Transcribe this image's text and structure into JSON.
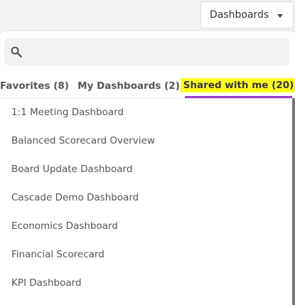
{
  "dropdown_button": {
    "label": "Dashboards"
  },
  "search": {
    "placeholder": "",
    "value": ""
  },
  "tabs": [
    {
      "label": "Favorites (8)",
      "active": false
    },
    {
      "label": "My Dashboards (2)",
      "active": false
    },
    {
      "label": "Shared with me (20)",
      "active": true
    }
  ],
  "dashboards": [
    "1:1 Meeting Dashboard",
    "Balanced Scorecard Overview",
    "Board Update Dashboard",
    "Cascade Demo Dashboard",
    "Economics Dashboard",
    "Financial Scorecard",
    "KPI Dashboard"
  ],
  "colors": {
    "active_tab_underline": "#9c3fcc",
    "active_tab_highlight": "#ffff1e"
  }
}
